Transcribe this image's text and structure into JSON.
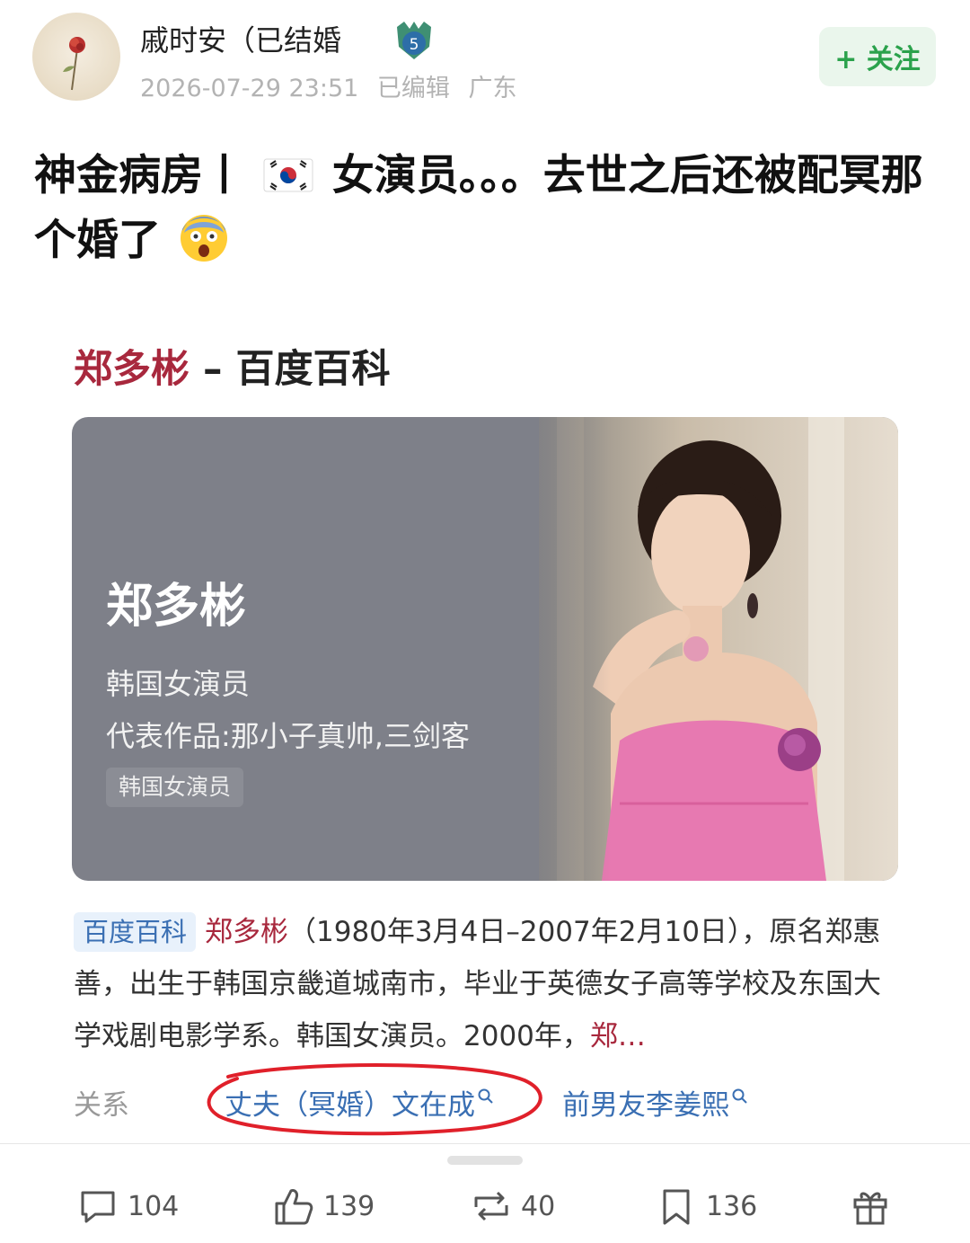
{
  "post": {
    "author": {
      "name": "戚时安（已结婚",
      "level": "5",
      "timestamp": "2026-07-29 23:51",
      "edited": "已编辑",
      "location": "广东",
      "follow_label": "+ 关注"
    },
    "title_part1": "神金病房丨",
    "title_part2": "女演员。。。去世之后还被配冥那个婚了",
    "emoji_flag": "korea-flag-icon",
    "emoji_face": "shocked-face-icon"
  },
  "baike": {
    "title_name": "郑多彬",
    "title_rest": " – 百度百科",
    "card": {
      "name": "郑多彬",
      "line1": "韩国女演员",
      "line2": "代表作品:那小子真帅,三剑客",
      "tag": "韩国女演员"
    },
    "summary": {
      "source": "百度百科",
      "name": "郑多彬",
      "text": "（1980年3月4日–2007年2月10日），原名郑惠善，出生于韩国京畿道城南市，毕业于英德女子高等学校及东国大学戏剧电影学系。韩国女演员。2000年，",
      "tail": "郑…"
    },
    "relations": {
      "label": "关系",
      "item1": "丈夫（冥婚）文在成",
      "item2": "前男友李姜熙"
    }
  },
  "actions": {
    "comments": "104",
    "likes": "139",
    "reposts": "40",
    "favorites": "136"
  },
  "colors": {
    "accent_green": "#2ba24c",
    "highlight_red": "#a8283d",
    "link_blue": "#3a6fb3"
  }
}
